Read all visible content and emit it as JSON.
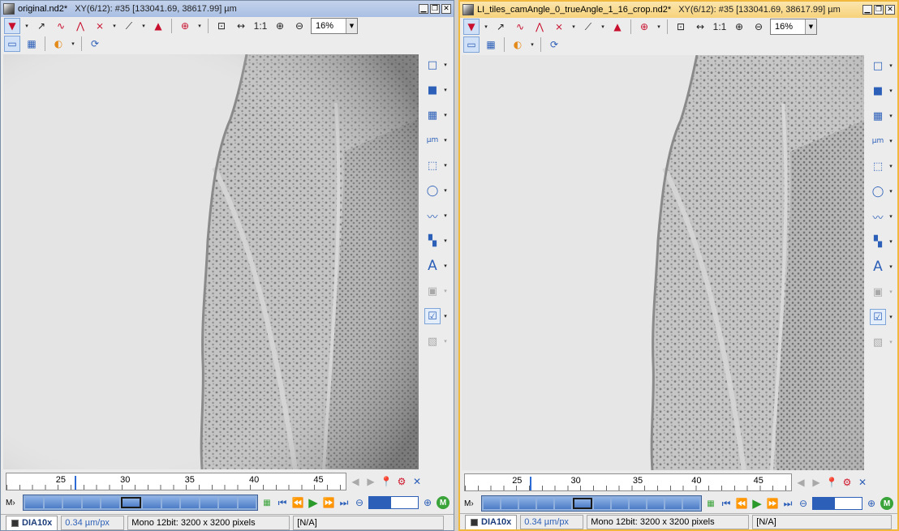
{
  "windows": [
    {
      "title": "original.nd2*",
      "info": "XY(6/12): #35 [133041.69, 38617.99] µm",
      "zoom": "16%",
      "zoom_fixed": "1:1",
      "timeline_ticks": [
        "25",
        "30",
        "35",
        "40",
        "45"
      ],
      "playbar_label": "M›",
      "tab_label": "DIA10x",
      "scale": "0.34 µm/px",
      "image_info": "Mono 12bit: 3200 x 3200 pixels",
      "extra": "[N/A]"
    },
    {
      "title": "LI_tiles_camAngle_0_trueAngle_1_16_crop.nd2*",
      "info": "XY(6/12): #35 [133041.69, 38617.99] µm",
      "zoom": "16%",
      "zoom_fixed": "1:1",
      "timeline_ticks": [
        "25",
        "30",
        "35",
        "40",
        "45"
      ],
      "playbar_label": "M›",
      "tab_label": "DIA10x",
      "scale": "0.34 µm/px",
      "image_info": "Mono 12bit: 3200 x 3200 pixels",
      "extra": "[N/A]"
    }
  ],
  "window_controls": {
    "minimize": "▁",
    "restore": "❐",
    "close": "✕"
  },
  "side_tool_icons": [
    "rectangle-icon",
    "filled-rectangle-icon",
    "grid-icon",
    "scale-bar-icon",
    "crop-icon",
    "ellipse-icon",
    "wave-icon",
    "bookmark-icon",
    "text-icon",
    "thumbnail-icon",
    "overlay-icon",
    "disabled-overlay-icon"
  ],
  "side_tool_glyphs": [
    "□",
    "■",
    "▦",
    "µm",
    "⬚",
    "◯",
    "〰",
    "▚",
    "A",
    "▣",
    "☑",
    "▧"
  ],
  "side_tool_dropdown": "▾",
  "timeline_cursor_fraction": 0.2,
  "current_frame_index": 5,
  "frame_count": 12,
  "colors": {
    "active_title": "#f6d27b",
    "inactive_title": "#a9bfe3",
    "accent_blue": "#2c5fb8",
    "play_green": "#2a9a2a",
    "marker_red": "#d0152a"
  }
}
